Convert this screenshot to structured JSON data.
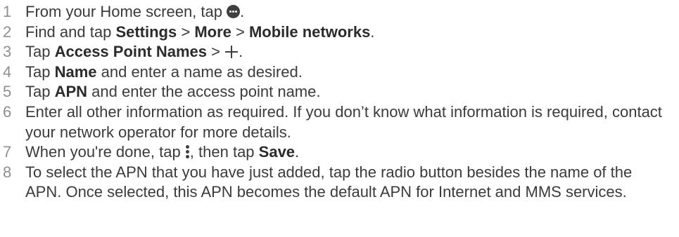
{
  "steps": [
    {
      "num": "1",
      "t1": "From your Home screen, tap ",
      "t2": "."
    },
    {
      "num": "2",
      "t1": "Find and tap ",
      "b1": "Settings",
      "t2": " > ",
      "b2": "More",
      "t3": " > ",
      "b3": "Mobile networks",
      "t4": "."
    },
    {
      "num": "3",
      "t1": "Tap ",
      "b1": "Access Point Names",
      "t2": " > ",
      "t3": "."
    },
    {
      "num": "4",
      "t1": "Tap ",
      "b1": "Name",
      "t2": " and enter a name as desired."
    },
    {
      "num": "5",
      "t1": "Tap ",
      "b1": "APN",
      "t2": " and enter the access point name."
    },
    {
      "num": "6",
      "t1": "Enter all other information as required. If you don’t know what information is required, contact your network operator for more details."
    },
    {
      "num": "7",
      "t1": "When you're done, tap ",
      "t2": ", then tap ",
      "b1": "Save",
      "t3": "."
    },
    {
      "num": "8",
      "t1": "To select the APN that you have just added, tap the radio button besides the name of the APN. Once selected, this APN becomes the default APN for Internet and MMS services."
    }
  ],
  "icons": {
    "step1": "apps-icon",
    "step3": "add-icon",
    "step7": "more-options-icon"
  }
}
